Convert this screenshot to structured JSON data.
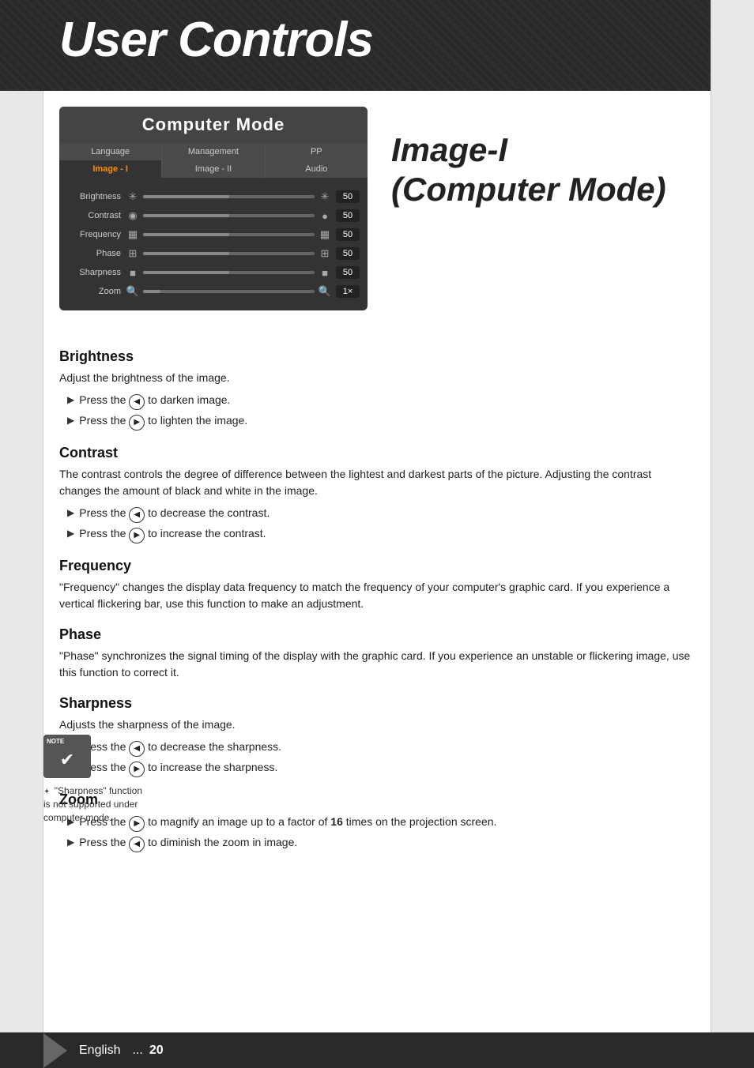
{
  "header": {
    "title": "User Controls",
    "background_color": "#2a2a2a"
  },
  "panel": {
    "title": "Computer Mode",
    "tabs": [
      {
        "label": "Language",
        "active": false
      },
      {
        "label": "Management",
        "active": false
      },
      {
        "label": "PP",
        "active": false
      },
      {
        "label": "Image - I",
        "active": true
      },
      {
        "label": "Image - II",
        "active": false
      },
      {
        "label": "Audio",
        "active": false
      }
    ],
    "settings": [
      {
        "label": "Brightness",
        "icon_left": "✳",
        "icon_right": "✳",
        "value": "50",
        "fill": 50
      },
      {
        "label": "Contrast",
        "icon_left": "◉",
        "icon_right": "●",
        "value": "50",
        "fill": 50
      },
      {
        "label": "Frequency",
        "icon_left": "🖥",
        "icon_right": "🖥",
        "value": "50",
        "fill": 50
      },
      {
        "label": "Phase",
        "icon_left": "⊡",
        "icon_right": "⊡",
        "value": "50",
        "fill": 50
      },
      {
        "label": "Sharpness",
        "icon_left": "■",
        "icon_right": "■",
        "value": "50",
        "fill": 50
      },
      {
        "label": "Zoom",
        "icon_left": "🔍",
        "icon_right": "🔍",
        "value": "1×",
        "fill": 10
      }
    ]
  },
  "image_title": {
    "line1": "Image-I",
    "line2": "(Computer Mode)"
  },
  "sections": [
    {
      "id": "brightness",
      "heading": "Brightness",
      "body": "Adjust the brightness of the image.",
      "bullets": [
        {
          "text": "Press the ",
          "btn": "◀",
          "suffix": " to darken image."
        },
        {
          "text": "Press the ",
          "btn": "▶",
          "suffix": " to lighten the image."
        }
      ]
    },
    {
      "id": "contrast",
      "heading": "Contrast",
      "body": "The contrast controls the degree of difference between the lightest and darkest parts of the picture. Adjusting the contrast changes the amount of black and white in the image.",
      "bullets": [
        {
          "text": "Press the ",
          "btn": "◀",
          "suffix": " to decrease the contrast."
        },
        {
          "text": "Press the ",
          "btn": "▶",
          "suffix": " to increase the contrast."
        }
      ]
    },
    {
      "id": "frequency",
      "heading": "Frequency",
      "body": "\"Frequency\" changes the display data frequency to match the frequency of your computer's graphic card. If you experience a vertical flickering bar, use this function to make an adjustment.",
      "bullets": []
    },
    {
      "id": "phase",
      "heading": "Phase",
      "body": "\"Phase\" synchronizes the signal timing of the display with the graphic card. If you experience an unstable or flickering image, use this function to correct it.",
      "bullets": []
    },
    {
      "id": "sharpness",
      "heading": "Sharpness",
      "body": "Adjusts the sharpness of the image.",
      "bullets": [
        {
          "text": "Press the ",
          "btn": "◀",
          "suffix": " to decrease the sharpness."
        },
        {
          "text": "Press the ",
          "btn": "▶",
          "suffix": " to increase the sharpness."
        }
      ]
    },
    {
      "id": "zoom",
      "heading": "Zoom",
      "body": "",
      "bullets": [
        {
          "text": "Press the ",
          "btn": "▶",
          "suffix": " to magnify an image up to a factor of 16 times on the projection screen."
        },
        {
          "text": "Press the ",
          "btn": "◀",
          "suffix": " to diminish the zoom in image."
        }
      ]
    }
  ],
  "note": {
    "label": "NOTE",
    "text": "\"Sharpness\" function is not supported under computer mode."
  },
  "footer": {
    "language": "English",
    "ellipsis": "...",
    "page": "20"
  }
}
